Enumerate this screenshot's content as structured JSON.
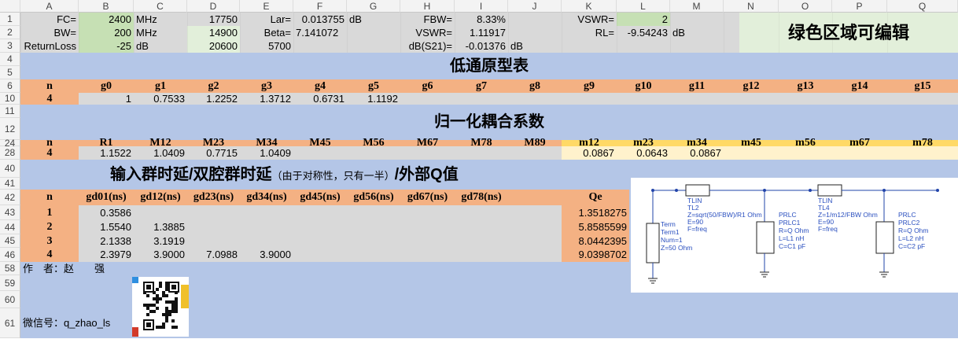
{
  "columns": [
    "A",
    "B",
    "C",
    "D",
    "E",
    "F",
    "G",
    "H",
    "I",
    "J",
    "K",
    "L",
    "M",
    "N",
    "O",
    "P",
    "Q"
  ],
  "rows": [
    "1",
    "2",
    "3",
    "4",
    "5",
    "6",
    "10",
    "11",
    "12",
    "24",
    "28",
    "40",
    "41",
    "42",
    "43",
    "44",
    "45",
    "46",
    "58",
    "59",
    "60",
    "61"
  ],
  "params": {
    "fc_label": "FC=",
    "fc_value": "2400",
    "fc_unit": "MHz",
    "d1": "17750",
    "lar_label": "Lar=",
    "lar_value": "0.013755",
    "lar_unit": "dB",
    "fbw_label": "FBW=",
    "fbw_value": "8.33%",
    "vswr_label1": "VSWR=",
    "vswr_value1": "2",
    "bw_label": "BW=",
    "bw_value": "200",
    "bw_unit": "MHz",
    "d2": "14900",
    "beta_label": "Beta=",
    "beta_value": "7.141072",
    "vswr_label2": "VSWR=",
    "vswr_value2": "1.11917",
    "rl_label": "RL=",
    "rl_value": "-9.54243",
    "rl_unit": "dB",
    "rl3_label": "ReturnLoss",
    "rl3_value": "-25",
    "rl3_unit": "dB",
    "d3": "20600",
    "e3": "5700",
    "s21_label": "dB(S21)=",
    "s21_value": "-0.01376",
    "s21_unit": "dB",
    "note": "绿色区域可编辑"
  },
  "lowpass": {
    "title": "低通原型表",
    "headers": [
      "n",
      "g0",
      "g1",
      "g2",
      "g3",
      "g4",
      "g5",
      "g6",
      "g7",
      "g8",
      "g9",
      "g10",
      "g11",
      "g12",
      "g13",
      "g14",
      "g15"
    ],
    "values": [
      "4",
      "1",
      "0.7533",
      "1.2252",
      "1.3712",
      "0.6731",
      "1.1192",
      "",
      "",
      "",
      "",
      "",
      "",
      "",
      "",
      "",
      ""
    ]
  },
  "coupling": {
    "title": "归一化耦合系数",
    "headers": [
      "n",
      "R1",
      "M12",
      "M23",
      "M34",
      "M45",
      "M56",
      "M67",
      "M78",
      "M89",
      "m12",
      "m23",
      "m34",
      "m45",
      "m56",
      "m67",
      "m78"
    ],
    "values": [
      "4",
      "1.1522",
      "1.0409",
      "0.7715",
      "1.0409",
      "",
      "",
      "",
      "",
      "",
      "0.0867",
      "0.0643",
      "0.0867",
      "",
      "",
      "",
      ""
    ]
  },
  "delay": {
    "title_main": "输入群时延/双腔群时延",
    "title_note": "（由于对称性，只有一半）",
    "title_tail": "/外部Q值",
    "headers": [
      "n",
      "gd01(ns)",
      "gd12(ns)",
      "gd23(ns)",
      "gd34(ns)",
      "gd45(ns)",
      "gd56(ns)",
      "gd67(ns)",
      "gd78(ns)",
      "",
      "",
      "Qe"
    ],
    "rows": [
      {
        "n": "1",
        "gd01": "0.3586",
        "gd12": "",
        "gd23": "",
        "gd34": "",
        "qe": "1.3518275"
      },
      {
        "n": "2",
        "gd01": "1.5540",
        "gd12": "1.3885",
        "gd23": "",
        "gd34": "",
        "qe": "5.8585599"
      },
      {
        "n": "3",
        "gd01": "2.1338",
        "gd12": "3.1919",
        "gd23": "",
        "gd34": "",
        "qe": "8.0442395"
      },
      {
        "n": "4",
        "gd01": "2.3979",
        "gd12": "3.9000",
        "gd23": "7.0988",
        "gd34": "3.9000",
        "qe": "9.0398702"
      }
    ]
  },
  "author": {
    "line1": "作　者：赵　　强",
    "line2": "微信号：q_zhao_ls"
  },
  "schematic": {
    "tlin1": [
      "TLIN",
      "TL2",
      "Z=sqrt(50/FBW)/R1 Ohm",
      "E=90",
      "F=freq"
    ],
    "tlin2": [
      "TLIN",
      "TL4",
      "Z=1/m12/FBW Ohm",
      "E=90",
      "F=freq"
    ],
    "term": [
      "Term",
      "Term1",
      "Num=1",
      "Z=50 Ohm"
    ],
    "prlc1": [
      "PRLC",
      "PRLC1",
      "R=Q Ohm",
      "L=L1 nH",
      "C=C1 pF"
    ],
    "prlc2": [
      "PRLC",
      "PRLC2",
      "R=Q Ohm",
      "L=L2 nH",
      "C=C2 pF"
    ]
  }
}
